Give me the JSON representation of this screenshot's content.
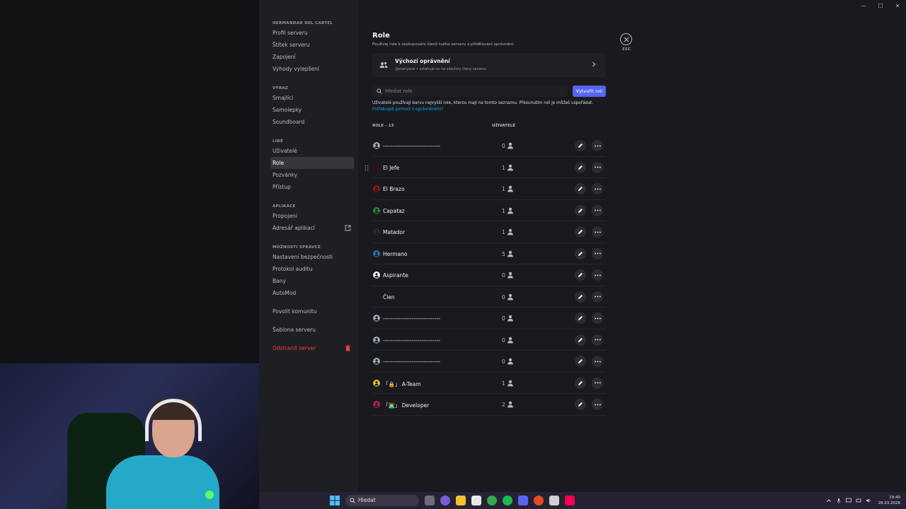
{
  "sidebar": {
    "sections": [
      {
        "header": "HERMANDAD DEL CARTEL",
        "items": [
          "Profil serveru",
          "Štítek serveru",
          "Zapojení",
          "Výhody vylepšení"
        ]
      },
      {
        "header": "VÝRAZ",
        "items": [
          "Smajlíci",
          "Samolepky",
          "Soundboard"
        ]
      },
      {
        "header": "LIDÉ",
        "items": [
          "Uživatelé",
          "Role",
          "Pozvánky",
          "Přístup"
        ]
      },
      {
        "header": "APLIKACE",
        "items": [
          "Propojení",
          "Adresář aplikací"
        ]
      },
      {
        "header": "MOŽNOSTI SPRÁVCE",
        "items": [
          "Nastavení bezpečnosti",
          "Protokol auditu",
          "Bany",
          "AutoMod"
        ]
      }
    ],
    "extra": [
      "Povolit komunitu",
      "Šablona serveru",
      "Odstranit server"
    ],
    "active_item": "Role"
  },
  "page": {
    "title": "Role",
    "subtitle": "Používej role k seskupování členů tvého serveru a přidělování oprávnění.",
    "default_perm_title": "Výchozí oprávnění",
    "default_perm_sub": "@everyone • vztahuje se na všechny členy serveru",
    "search_placeholder": "Hledat role",
    "create_label": "Vytvořit roli",
    "info_text": "Uživatelé používají barvu nejvyšší role, kterou mají na tomto seznamu. Přesunutím rolí je můžeš uspořádat.",
    "info_link": "Potřebuješ pomoct s oprávněními?",
    "col_roles": "ROLE – 13",
    "col_users": "UŽIVATELÉ",
    "esc_label": "ESC"
  },
  "roles": [
    {
      "name": "------------------------------",
      "count": "0",
      "color": "#99aab5"
    },
    {
      "name": "El Jefe",
      "count": "1",
      "color": "#3a0d0d"
    },
    {
      "name": "El Brazo",
      "count": "1",
      "color": "#8b1a1a"
    },
    {
      "name": "Capataz",
      "count": "1",
      "color": "#1f8b3a"
    },
    {
      "name": "Matador",
      "count": "1",
      "color": "#2a2c33"
    },
    {
      "name": "Hermano",
      "count": "5",
      "color": "#2f6fb5"
    },
    {
      "name": "Aspirante",
      "count": "0",
      "color": "#ffffff"
    },
    {
      "name": "Člen",
      "count": "0",
      "color": "#1a1a1a"
    },
    {
      "name": "------------------------------",
      "count": "0",
      "color": "#99aab5"
    },
    {
      "name": "------------------------------",
      "count": "0",
      "color": "#99aab5"
    },
    {
      "name": "------------------------------",
      "count": "0",
      "color": "#99aab5"
    },
    {
      "name": "「🔒」 A-Team",
      "count": "1",
      "color": "#e8c33a"
    },
    {
      "name": "「👨‍💻」 Developer",
      "count": "2",
      "color": "#c2185b"
    }
  ],
  "taskbar": {
    "search_label": "Hledat",
    "time": "19:40",
    "date": "28.03.2026"
  }
}
